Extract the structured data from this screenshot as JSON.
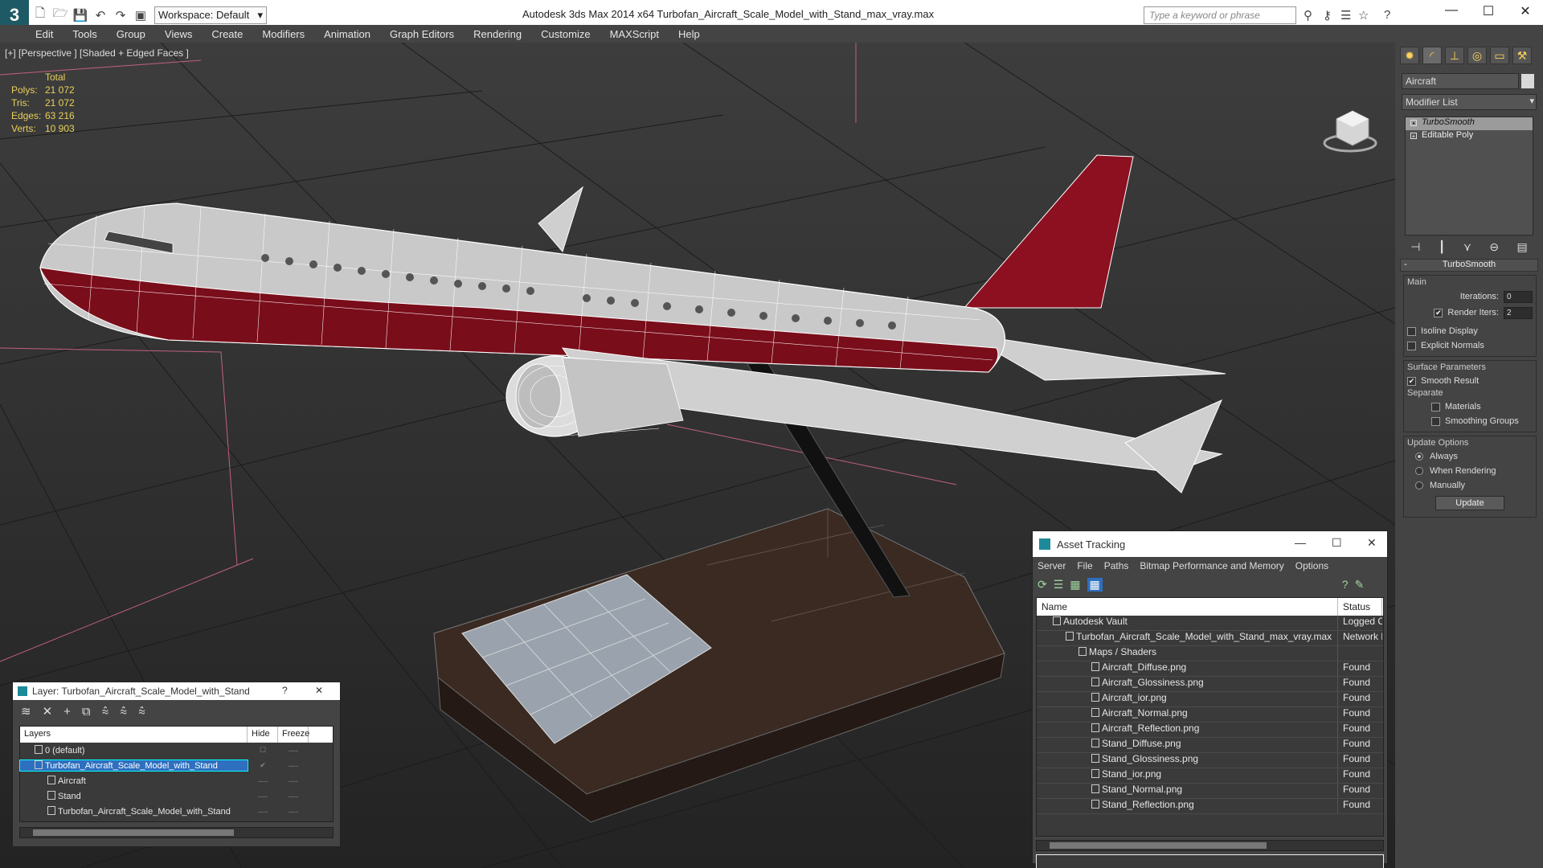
{
  "titlebar": {
    "app_logo": "3",
    "workspace_label": "Workspace: Default",
    "window_title": "Autodesk 3ds Max  2014 x64     Turbofan_Aircraft_Scale_Model_with_Stand_max_vray.max",
    "search_placeholder": "Type a keyword or phrase",
    "minimize": "—",
    "maximize": "☐",
    "close": "✕"
  },
  "menu": {
    "items": [
      "Edit",
      "Tools",
      "Group",
      "Views",
      "Create",
      "Modifiers",
      "Animation",
      "Graph Editors",
      "Rendering",
      "Customize",
      "MAXScript",
      "Help"
    ]
  },
  "viewport": {
    "label": "[+] [Perspective ] [Shaded + Edged Faces ]",
    "stats": {
      "header": "Total",
      "rows": [
        {
          "label": "Polys:",
          "value": "21 072"
        },
        {
          "label": "Tris:",
          "value": "21 072"
        },
        {
          "label": "Edges:",
          "value": "63 216"
        },
        {
          "label": "Verts:",
          "value": "10 903"
        }
      ]
    }
  },
  "command_panel": {
    "object_name": "Aircraft",
    "modifier_list": "Modifier List",
    "stack": [
      "TurboSmooth",
      "Editable Poly"
    ],
    "rollout_title": "TurboSmooth",
    "main_group": "Main",
    "iterations_label": "Iterations:",
    "iterations_value": "0",
    "render_iters_label": "Render Iters:",
    "render_iters_value": "2",
    "isoline_label": "Isoline Display",
    "explicit_label": "Explicit Normals",
    "surface_group": "Surface Parameters",
    "smooth_result": "Smooth Result",
    "separate": "Separate",
    "materials": "Materials",
    "smoothing_groups": "Smoothing Groups",
    "update_group": "Update Options",
    "always": "Always",
    "when_rendering": "When Rendering",
    "manually": "Manually",
    "update_button": "Update"
  },
  "asset_tracking": {
    "title": "Asset Tracking",
    "menu": [
      "Server",
      "File",
      "Paths",
      "Bitmap Performance and Memory",
      "Options"
    ],
    "columns": [
      "Name",
      "Status"
    ],
    "rows": [
      {
        "name": "Autodesk Vault",
        "status": "Logged Ou"
      },
      {
        "name": "Turbofan_Aircraft_Scale_Model_with_Stand_max_vray.max",
        "status": "Network P"
      },
      {
        "name": "Maps / Shaders",
        "status": ""
      },
      {
        "name": "Aircraft_Diffuse.png",
        "status": "Found"
      },
      {
        "name": "Aircraft_Glossiness.png",
        "status": "Found"
      },
      {
        "name": "Aircraft_ior.png",
        "status": "Found"
      },
      {
        "name": "Aircraft_Normal.png",
        "status": "Found"
      },
      {
        "name": "Aircraft_Reflection.png",
        "status": "Found"
      },
      {
        "name": "Stand_Diffuse.png",
        "status": "Found"
      },
      {
        "name": "Stand_Glossiness.png",
        "status": "Found"
      },
      {
        "name": "Stand_ior.png",
        "status": "Found"
      },
      {
        "name": "Stand_Normal.png",
        "status": "Found"
      },
      {
        "name": "Stand_Reflection.png",
        "status": "Found"
      }
    ]
  },
  "layer_dialog": {
    "title": "Layer: Turbofan_Aircraft_Scale_Model_with_Stand",
    "help": "?",
    "close": "✕",
    "columns": [
      "Layers",
      "Hide",
      "Freeze"
    ],
    "rows": [
      {
        "name": "0 (default)"
      },
      {
        "name": "Turbofan_Aircraft_Scale_Model_with_Stand"
      },
      {
        "name": "Aircraft"
      },
      {
        "name": "Stand"
      },
      {
        "name": "Turbofan_Aircraft_Scale_Model_with_Stand"
      }
    ]
  }
}
